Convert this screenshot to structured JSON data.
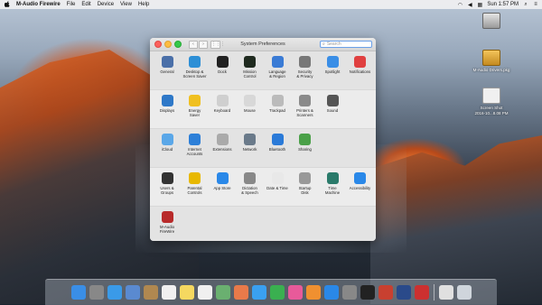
{
  "menubar": {
    "apple": "",
    "app_name": "M-Audio Firewire",
    "items": [
      "File",
      "Edit",
      "Device",
      "View",
      "Help"
    ],
    "clock": "Sun 1:57 PM"
  },
  "desktop": {
    "icons": [
      {
        "label": ""
      },
      {
        "label": "M-Audio Drivers.pkg"
      },
      {
        "label": "Screen Shot\n2016-10...8.08 PM"
      }
    ]
  },
  "window": {
    "title": "System Preferences",
    "search_placeholder": "Search",
    "back": "‹",
    "forward": "›",
    "grid": "⋮⋮⋮"
  },
  "sections": [
    [
      {
        "label": "General",
        "icon": "general-icon",
        "color": "#4a6fa8"
      },
      {
        "label": "Desktop &\nScreen Saver",
        "icon": "desktop-icon",
        "color": "#2d8fd6"
      },
      {
        "label": "Dock",
        "icon": "dock-icon",
        "color": "#222"
      },
      {
        "label": "Mission\nControl",
        "icon": "mission-control-icon",
        "color": "#1f2a1f"
      },
      {
        "label": "Language\n& Region",
        "icon": "language-icon",
        "color": "#3a7bd5"
      },
      {
        "label": "Security\n& Privacy",
        "icon": "security-icon",
        "color": "#777"
      },
      {
        "label": "Spotlight",
        "icon": "spotlight-icon",
        "color": "#3a8ee6"
      },
      {
        "label": "Notifications",
        "icon": "notifications-icon",
        "color": "#e04040"
      }
    ],
    [
      {
        "label": "Displays",
        "icon": "displays-icon",
        "color": "#2e78c8"
      },
      {
        "label": "Energy\nSaver",
        "icon": "energy-icon",
        "color": "#f0c020"
      },
      {
        "label": "Keyboard",
        "icon": "keyboard-icon",
        "color": "#cfcfcf"
      },
      {
        "label": "Mouse",
        "icon": "mouse-icon",
        "color": "#d8d8d8"
      },
      {
        "label": "Trackpad",
        "icon": "trackpad-icon",
        "color": "#bbbbbb"
      },
      {
        "label": "Printers &\nScanners",
        "icon": "printer-icon",
        "color": "#8a8a8a"
      },
      {
        "label": "Sound",
        "icon": "sound-icon",
        "color": "#555"
      }
    ],
    [
      {
        "label": "iCloud",
        "icon": "icloud-icon",
        "color": "#5aa7e8"
      },
      {
        "label": "Internet\nAccounts",
        "icon": "internet-accounts-icon",
        "color": "#2c7fd8"
      },
      {
        "label": "Extensions",
        "icon": "extensions-icon",
        "color": "#aaaaaa"
      },
      {
        "label": "Network",
        "icon": "network-icon",
        "color": "#6a7a8a"
      },
      {
        "label": "Bluetooth",
        "icon": "bluetooth-icon",
        "color": "#2a7ad8"
      },
      {
        "label": "Sharing",
        "icon": "sharing-icon",
        "color": "#4aa048"
      }
    ],
    [
      {
        "label": "Users &\nGroups",
        "icon": "users-icon",
        "color": "#333"
      },
      {
        "label": "Parental\nControls",
        "icon": "parental-icon",
        "color": "#e8b800"
      },
      {
        "label": "App Store",
        "icon": "app-store-icon",
        "color": "#2a88e8"
      },
      {
        "label": "Dictation\n& Speech",
        "icon": "dictation-icon",
        "color": "#888"
      },
      {
        "label": "Date & Time",
        "icon": "clock-icon",
        "color": "#e8e8e8"
      },
      {
        "label": "Startup\nDisk",
        "icon": "startup-disk-icon",
        "color": "#999"
      },
      {
        "label": "Time\nMachine",
        "icon": "time-machine-icon",
        "color": "#2a7a6a"
      },
      {
        "label": "Accessibility",
        "icon": "accessibility-icon",
        "color": "#2a88e8"
      }
    ],
    [
      {
        "label": "M-Audio\nFireWire",
        "icon": "m-audio-icon",
        "color": "#b82a2a"
      }
    ]
  ],
  "dock": [
    {
      "name": "finder-icon",
      "color": "#3a8ee6"
    },
    {
      "name": "launchpad-icon",
      "color": "#888"
    },
    {
      "name": "safari-icon",
      "color": "#3a9ae8"
    },
    {
      "name": "preview-icon",
      "color": "#5a8ad0"
    },
    {
      "name": "contacts-icon",
      "color": "#b08850"
    },
    {
      "name": "calendar-icon",
      "color": "#f0f0f0"
    },
    {
      "name": "notes-icon",
      "color": "#f5d860"
    },
    {
      "name": "reminders-icon",
      "color": "#f0f0f0"
    },
    {
      "name": "maps-icon",
      "color": "#6ab070"
    },
    {
      "name": "photos-icon",
      "color": "#e87a4a"
    },
    {
      "name": "messages-icon",
      "color": "#3aa0f0"
    },
    {
      "name": "facetime-icon",
      "color": "#3ab050"
    },
    {
      "name": "itunes-icon",
      "color": "#e85a9a"
    },
    {
      "name": "ibooks-icon",
      "color": "#f09030"
    },
    {
      "name": "app-store-dock-icon",
      "color": "#2a88e8"
    },
    {
      "name": "system-preferences-icon",
      "color": "#888"
    },
    {
      "name": "piano-icon",
      "color": "#222"
    },
    {
      "name": "sound-wave-icon",
      "color": "#c84030"
    },
    {
      "name": "quicktime-icon",
      "color": "#2a4a8a"
    },
    {
      "name": "disk-utility-icon",
      "color": "#cc3030"
    },
    {
      "name": "downloads-icon",
      "color": "#e0e0e0"
    },
    {
      "name": "trash-icon",
      "color": "#cfd5dc"
    }
  ]
}
